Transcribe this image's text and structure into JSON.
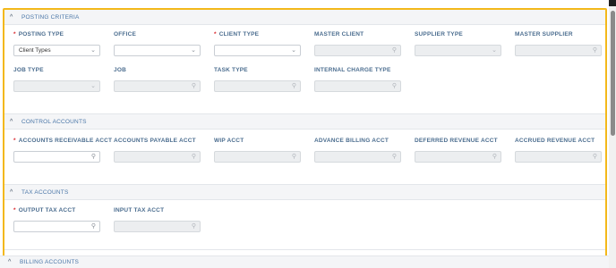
{
  "sections": {
    "posting": {
      "title": "POSTING CRITERIA"
    },
    "control": {
      "title": "CONTROL ACCOUNTS"
    },
    "tax": {
      "title": "TAX ACCOUNTS"
    },
    "billing": {
      "title": "BILLING ACCOUNTS"
    }
  },
  "fields": {
    "posting_type": {
      "label": "POSTING TYPE",
      "value": "Client Types"
    },
    "office": {
      "label": "OFFICE",
      "value": ""
    },
    "client_type": {
      "label": "CLIENT TYPE",
      "value": ""
    },
    "master_client": {
      "label": "MASTER CLIENT",
      "value": ""
    },
    "supplier_type": {
      "label": "SUPPLIER TYPE",
      "value": ""
    },
    "master_supplier": {
      "label": "MASTER SUPPLIER",
      "value": ""
    },
    "job_type": {
      "label": "JOB TYPE",
      "value": ""
    },
    "job": {
      "label": "JOB",
      "value": ""
    },
    "task_type": {
      "label": "TASK TYPE",
      "value": ""
    },
    "internal_charge_type": {
      "label": "INTERNAL CHARGE TYPE",
      "value": ""
    },
    "ar_acct": {
      "label": "ACCOUNTS RECEIVABLE ACCT",
      "value": ""
    },
    "ap_acct": {
      "label": "ACCOUNTS PAYABLE ACCT",
      "value": ""
    },
    "wip_acct": {
      "label": "WIP ACCT",
      "value": ""
    },
    "advance_billing_acct": {
      "label": "ADVANCE BILLING ACCT",
      "value": ""
    },
    "deferred_revenue_acct": {
      "label": "DEFERRED REVENUE ACCT",
      "value": ""
    },
    "accrued_revenue_acct": {
      "label": "ACCRUED REVENUE ACCT",
      "value": ""
    },
    "output_tax_acct": {
      "label": "OUTPUT TAX ACCT",
      "value": ""
    },
    "input_tax_acct": {
      "label": "INPUT TAX ACCT",
      "value": ""
    }
  },
  "icons": {
    "chevron_up": "^",
    "chevron_down": "⌄",
    "search": "⚲",
    "required": "*"
  },
  "colors": {
    "highlight_border": "#f3b81a",
    "required": "#d9262c",
    "section_text": "#4b77a8"
  }
}
